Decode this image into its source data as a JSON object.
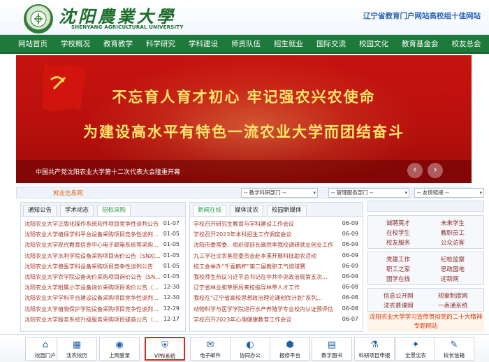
{
  "header": {
    "logo_name": "沈阳農業大學",
    "logo_sub": "SHENYANG AGRICULTURAL UNIVERSITY",
    "right_text": "辽宁省教育门户网站高校组十佳网站"
  },
  "nav": {
    "items": [
      "网站首页",
      "学校概况",
      "教育教学",
      "科学研究",
      "学科建设",
      "师资队伍",
      "招生就业",
      "国际交流",
      "校园文化",
      "教育基金会",
      "校友总会"
    ]
  },
  "banner": {
    "line1": "不忘育人育才初心 牢记强农兴农使命",
    "line2": "为建设高水平有特色一流农业大学而团结奋斗",
    "caption": "中国共产党沈阳农业大学第十二次代表大会隆重开幕",
    "prev": "‹",
    "next": "›"
  },
  "strip": {
    "title": "就业信息网",
    "select1": "-- 教学科研部门 --",
    "select2": "-- 管理服务部门 --",
    "select3": "-- 友情链接 --"
  },
  "left_panel": {
    "tabs": [
      "通知公告",
      "学术动态",
      "招标采购"
    ],
    "active_tab": 2,
    "rows": [
      {
        "title": "沈阳农业大学正版化操作系统软件项目竞争性谈判公告",
        "date": "01-07"
      },
      {
        "title": "沈阳农业大学植保学科平台设备采购项目竞争性谈判公告",
        "date": "01-05"
      },
      {
        "title": "沈阳农业大学现代教育信息中心电子邮箱系统等采购...",
        "date": "01-05"
      },
      {
        "title": "沈阳农业大学水利学院设备采购项目询价公告（SNXJC...",
        "date": "01-05"
      },
      {
        "title": "沈阳农业大学兽医学科设备采购项目竞争性谈判公告",
        "date": "01-05"
      },
      {
        "title": "沈阳农业大学农学院设备询价采购项目询价公告（SNX...",
        "date": "01-05"
      },
      {
        "title": "沈阳农业大学附属小学设备询价采购项目询价公告（S...",
        "date": "12-30"
      },
      {
        "title": "沈阳农业大学学科平台建设设备采购项目竞争性谈判公告",
        "date": "12-30"
      },
      {
        "title": "沈阳农业大学植物保护学院设备采购项目竞争性谈判公告",
        "date": "12-29"
      },
      {
        "title": "沈阳农业大学服务系统升级服务采购项目磋商公告（S...",
        "date": "12-17"
      }
    ]
  },
  "mid_panel": {
    "tabs": [
      "新闻在线",
      "媒体沈农",
      "校园新媒体"
    ],
    "active_tab": 0,
    "rows": [
      {
        "title": "学校召开研究生教育与学科建设工作会议",
        "date": "06-09"
      },
      {
        "title": "学校召开2023年本科招生工作调度会议",
        "date": "06-09"
      },
      {
        "title": "沈阳市委常委、组织部部长阚然率我校调研就业创业工作",
        "date": "06-09"
      },
      {
        "title": "九三学社沈农基层委员会赴本溪开展科技助农活动",
        "date": "06-09"
      },
      {
        "title": "校工会举办“千喜鹤杯”第二届教职工气排球赛",
        "date": "06-09"
      },
      {
        "title": "我校师生热议习近平总书记在中共中央政治局第五次...",
        "date": "06-09"
      },
      {
        "title": "辽宁省林业和草原局来校指导林草人才工作",
        "date": "06-08"
      },
      {
        "title": "我校在“辽宁省高校思想政治理论课创优计划”系列...",
        "date": "06-08"
      },
      {
        "title": "动物科学与医学学院进行水产养殖学专业校内认证预评估",
        "date": "06-08"
      },
      {
        "title": "学校召开2023年心理健康教育工作会议",
        "date": "06-07"
      }
    ]
  },
  "right_links": {
    "group1": [
      "诚聘英才",
      "未来学生",
      "在校学生",
      "教职员工",
      "校友服务",
      "公众访客"
    ],
    "group2": [
      "党建工作",
      "纪检监察",
      "职工之家",
      "思政园地",
      "团学在线",
      "迎新网"
    ],
    "group3": [
      "信息公开网",
      "规章制度网",
      "沈农慕课网",
      "一表通系统"
    ],
    "special": "沈阳农业大学学习宣传贯彻党的二十大精神专题网站"
  },
  "iconbar": {
    "items": [
      {
        "label": "校园门户",
        "icon": "portal-icon",
        "glyph": "⌂"
      },
      {
        "label": "沈农校历",
        "icon": "calendar-icon",
        "glyph": "▦"
      },
      {
        "label": "上网登录",
        "icon": "login-icon",
        "glyph": "◉"
      },
      {
        "label": "VPN系统",
        "icon": "vpn-icon",
        "glyph": "⛨"
      },
      {
        "label": "电子邮件",
        "icon": "mail-icon",
        "glyph": "✉"
      },
      {
        "label": "协同办公",
        "icon": "office-icon",
        "glyph": "◐"
      },
      {
        "label": "报修平台",
        "icon": "repair-icon",
        "glyph": "⬢"
      },
      {
        "label": "数字图书",
        "icon": "library-icon",
        "glyph": "▤"
      },
      {
        "label": "科研项目申报",
        "icon": "research-icon",
        "glyph": "⚗"
      },
      {
        "label": "全景沈农",
        "icon": "panorama-icon",
        "glyph": "✦"
      },
      {
        "label": "校长信箱",
        "icon": "president-mail-icon",
        "glyph": "✎"
      }
    ],
    "selected_index": 3
  },
  "colors": {
    "nav": "#1d7a3a",
    "banner_red": "#c7130f",
    "banner_text": "#ffe66b",
    "news_text": "#a33b2a",
    "accent_green": "#2a8a3f"
  }
}
